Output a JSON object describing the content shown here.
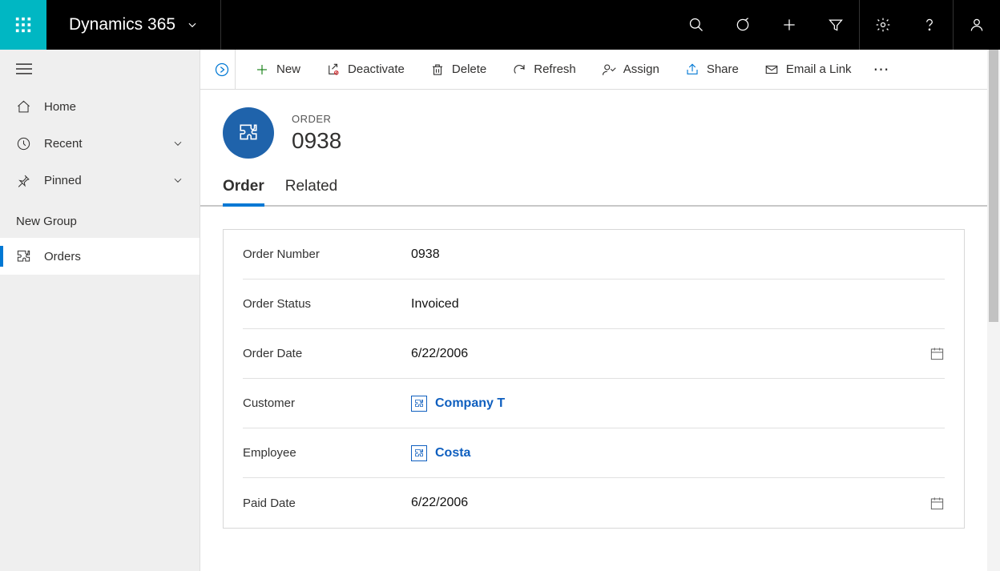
{
  "topbar": {
    "brand": "Dynamics 365"
  },
  "sidebar": {
    "home": "Home",
    "recent": "Recent",
    "pinned": "Pinned",
    "group_label": "New Group",
    "orders": "Orders"
  },
  "cmdbar": {
    "new": "New",
    "deactivate": "Deactivate",
    "delete": "Delete",
    "refresh": "Refresh",
    "assign": "Assign",
    "share": "Share",
    "email": "Email a Link"
  },
  "record": {
    "entity_label": "ORDER",
    "title": "0938"
  },
  "tabs": {
    "order": "Order",
    "related": "Related"
  },
  "fields": {
    "order_number": {
      "label": "Order Number",
      "value": "0938"
    },
    "order_status": {
      "label": "Order Status",
      "value": "Invoiced"
    },
    "order_date": {
      "label": "Order Date",
      "value": "6/22/2006"
    },
    "customer": {
      "label": "Customer",
      "value": "Company T"
    },
    "employee": {
      "label": "Employee",
      "value": "Costa"
    },
    "paid_date": {
      "label": "Paid Date",
      "value": "6/22/2006"
    }
  }
}
